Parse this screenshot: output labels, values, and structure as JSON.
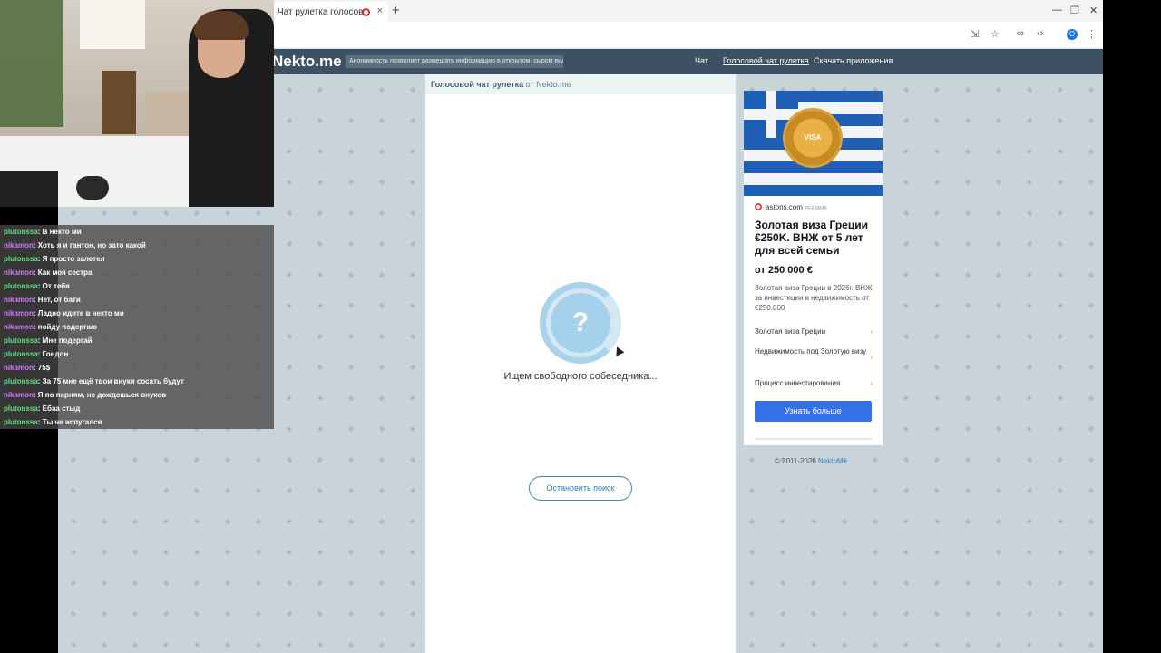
{
  "browser": {
    "tab_title": "Чат рулетка голосов",
    "tab_close": "×",
    "new_tab": "+",
    "profile_initial": "O",
    "window_controls": [
      "—",
      "❐",
      "✕"
    ]
  },
  "site": {
    "logo": "Nekto.me",
    "notice": "Анонимность позволяет размещать информацию в открытом, сыром виде!",
    "nav": [
      "Чат",
      "Голосовой чат рулетка",
      "Скачать приложения"
    ]
  },
  "panel": {
    "header_bold": "Голосовой чат рулетка",
    "header_rest": " от Nekto.me",
    "spinner_symbol": "?",
    "searching_text": "Ищем свободного собеседника...",
    "stop_button": "Остановить поиск"
  },
  "ad": {
    "menu": "•••",
    "seal_text": "VISA",
    "source": "astons.com",
    "source_tag": "РЕКЛАМА",
    "title": "Золотая виза Греции €250K. ВНЖ от 5 лет для всей семьи",
    "price": "от 250 000 €",
    "description": "Золотая виза Греции в 2026г. ВНЖ за инвестиции в недвижимость от €250.000",
    "links": [
      "Золотая виза Греции",
      "Недвижимость под Золотую визу",
      "Процесс инвестирования"
    ],
    "chevron": "›",
    "cta": "Узнать больше"
  },
  "footer": {
    "copyright": "© 2011-2026 ",
    "brand": "NektoMe"
  },
  "stream_chat": [
    {
      "user": "plutonssa",
      "text": ": В некто ми"
    },
    {
      "user": "nikamon",
      "text": ": Хоть я и гантон, но зато какой"
    },
    {
      "user": "plutonssa",
      "text": ": Я просто залетел"
    },
    {
      "user": "nikamon",
      "text": ": Как моя сестра"
    },
    {
      "user": "plutonssa",
      "text": ": От тебя"
    },
    {
      "user": "nikamon",
      "text": ": Нет, от бати"
    },
    {
      "user": "nikamon",
      "text": ": Ладно идите в некто ми"
    },
    {
      "user": "nikamon",
      "text": ": пойду подергаю"
    },
    {
      "user": "plutonssa",
      "text": ": Мне подергай"
    },
    {
      "user": "plutonssa",
      "text": ": Гондон"
    },
    {
      "user": "nikamon",
      "text": ": 75$"
    },
    {
      "user": "plutonssa",
      "text": ": За 75 мне ещё твои внуки сосать будут"
    },
    {
      "user": "nikamon",
      "text": ": Я по парням, не дождешься внуков"
    },
    {
      "user": "plutonssa",
      "text": ": Ебаа стыд"
    },
    {
      "user": "plutonssa",
      "text": ": Ты че испугался"
    }
  ],
  "colors": {
    "site_header": "#3e5063",
    "accent_blue": "#3471e8",
    "user_green": "#5fe07a",
    "user_purple": "#d07bff"
  }
}
